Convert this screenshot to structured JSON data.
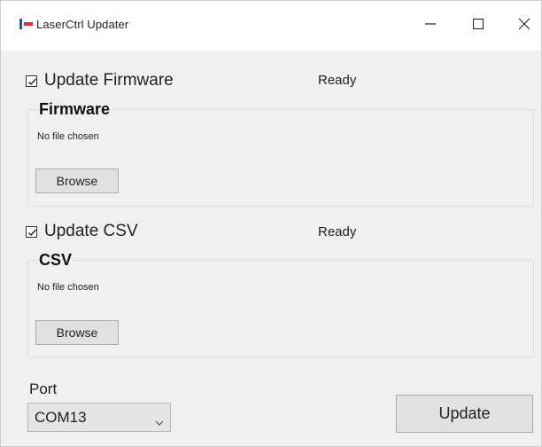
{
  "window": {
    "title": "LaserCtrl Updater",
    "minimize_glyph": "—",
    "maximize_glyph": "☐",
    "close_glyph": "✕"
  },
  "firmware": {
    "checkbox_label": "Update Firmware",
    "checked": true,
    "status": "Ready",
    "group_title": "Firmware",
    "file_label": "No file chosen",
    "browse_label": "Browse"
  },
  "csv": {
    "checkbox_label": "Update CSV",
    "checked": true,
    "status": "Ready",
    "group_title": "CSV",
    "file_label": "No file chosen",
    "browse_label": "Browse"
  },
  "port": {
    "label": "Port",
    "selected": "COM13"
  },
  "actions": {
    "update_label": "Update"
  },
  "icons": {
    "app": "app-icon",
    "minimize": "minimize-icon",
    "maximize": "maximize-icon",
    "close": "close-icon",
    "dropdown": "chevron-down-icon"
  },
  "colors": {
    "client_bg": "#f0f0f0",
    "button_bg": "#e1e1e1",
    "button_border": "#adadad"
  }
}
